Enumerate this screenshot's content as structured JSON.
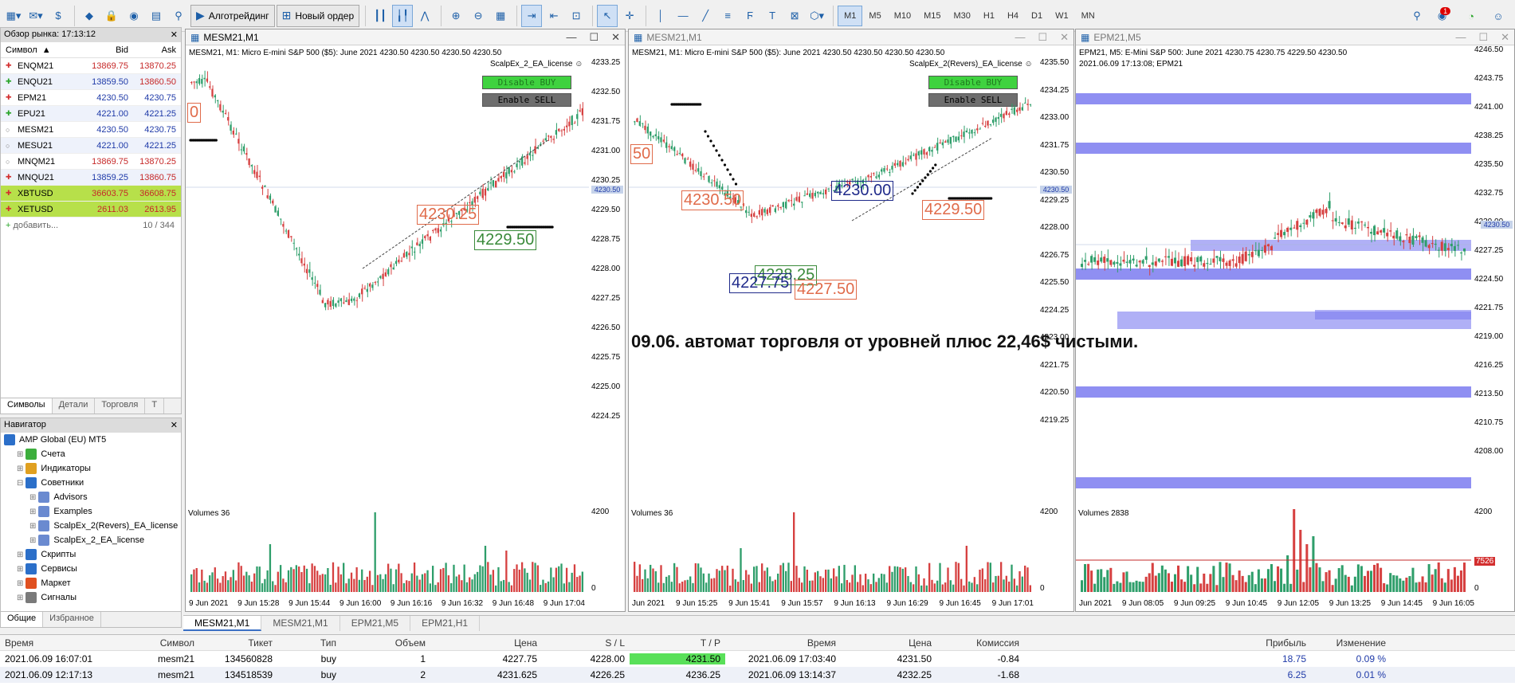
{
  "toolbar": {
    "algo_label": "Алготрейдинг",
    "order_label": "Новый ордер",
    "timeframes": [
      "M1",
      "M5",
      "M10",
      "M15",
      "M30",
      "H1",
      "H4",
      "D1",
      "W1",
      "MN"
    ],
    "active_tf": "M1",
    "notif_count": "1"
  },
  "market": {
    "title": "Обзор рынка: 17:13:12",
    "headers": {
      "symbol": "Символ",
      "bid": "Bid",
      "ask": "Ask"
    },
    "rows": [
      {
        "symbol": "ENQM21",
        "bid": "13869.75",
        "ask": "13870.25"
      },
      {
        "symbol": "ENQU21",
        "bid": "13859.50",
        "ask": "13860.50"
      },
      {
        "symbol": "EPM21",
        "bid": "4230.50",
        "ask": "4230.75"
      },
      {
        "symbol": "EPU21",
        "bid": "4221.00",
        "ask": "4221.25"
      },
      {
        "symbol": "MESM21",
        "bid": "4230.50",
        "ask": "4230.75"
      },
      {
        "symbol": "MESU21",
        "bid": "4221.00",
        "ask": "4221.25"
      },
      {
        "symbol": "MNQM21",
        "bid": "13869.75",
        "ask": "13870.25"
      },
      {
        "symbol": "MNQU21",
        "bid": "13859.25",
        "ask": "13860.75"
      },
      {
        "symbol": "XBTUSD",
        "bid": "36603.75",
        "ask": "36608.75"
      },
      {
        "symbol": "XETUSD",
        "bid": "2611.03",
        "ask": "2613.95"
      }
    ],
    "add_label": "добавить...",
    "count": "10 / 344",
    "tabs": [
      "Символы",
      "Детали",
      "Торговля",
      "Т"
    ]
  },
  "navigator": {
    "title": "Навигатор",
    "items": [
      {
        "label": "AMP Global (EU) MT5",
        "indent": 0
      },
      {
        "label": "Счета",
        "indent": 1
      },
      {
        "label": "Индикаторы",
        "indent": 1
      },
      {
        "label": "Советники",
        "indent": 1
      },
      {
        "label": "Advisors",
        "indent": 2
      },
      {
        "label": "Examples",
        "indent": 2
      },
      {
        "label": "ScalpEx_2(Revers)_EA_license",
        "indent": 2
      },
      {
        "label": "ScalpEx_2_EA_license",
        "indent": 2
      },
      {
        "label": "Скрипты",
        "indent": 1
      },
      {
        "label": "Сервисы",
        "indent": 1
      },
      {
        "label": "Маркет",
        "indent": 1
      },
      {
        "label": "Сигналы",
        "indent": 1
      }
    ],
    "tabs": [
      "Общие",
      "Избранное"
    ]
  },
  "charts": [
    {
      "title": "MESM21,M1",
      "info": "MESM21, M1:  Micro E-mini S&P 500 ($5): June 2021  4230.50 4230.50 4230.50 4230.50",
      "ea": "ScalpEx_2_EA_license",
      "btn1": "Disable BUY",
      "btn2": "Enable SELL",
      "prices": [
        "4233.25",
        "4232.50",
        "4231.75",
        "4231.00",
        "4230.25",
        "4229.50",
        "4228.75",
        "4228.00",
        "4227.25",
        "4226.50",
        "4225.75",
        "4225.00",
        "4224.25"
      ],
      "current": "4230.50",
      "vol": "Volumes 36",
      "vmax": "4200",
      "vmin": "0",
      "times": [
        "9 Jun 2021",
        "9 Jun 15:28",
        "9 Jun 15:44",
        "9 Jun 16:00",
        "9 Jun 16:16",
        "9 Jun 16:32",
        "9 Jun 16:48",
        "9 Jun 17:04"
      ],
      "labels": [
        "4230.25",
        "4229.50",
        "0"
      ]
    },
    {
      "title": "MESM21,M1",
      "info": "MESM21, M1:  Micro E-mini S&P 500 ($5): June 2021  4230.50 4230.50 4230.50 4230.50",
      "ea": "ScalpEx_2(Revers)_EA_license",
      "btn1": "Disable BUY",
      "btn2": "Enable SELL",
      "prices": [
        "4235.50",
        "4234.25",
        "4233.00",
        "4231.75",
        "4230.50",
        "4229.25",
        "4228.00",
        "4226.75",
        "4225.50",
        "4224.25",
        "4223.00",
        "4221.75",
        "4220.50",
        "4219.25"
      ],
      "current": "4230.50",
      "vol": "Volumes 36",
      "vmax": "4200",
      "vmin": "0",
      "times": [
        "Jun 2021",
        "9 Jun 15:25",
        "9 Jun 15:41",
        "9 Jun 15:57",
        "9 Jun 16:13",
        "9 Jun 16:29",
        "9 Jun 16:45",
        "9 Jun 17:01"
      ],
      "labels": [
        "4230.50",
        "4230.00",
        "4228.25",
        "4227.75",
        "4227.50",
        "4229.50",
        "50"
      ]
    },
    {
      "title": "EPM21,M5",
      "info": "EPM21, M5:  E-Mini S&P 500: June 2021  4230.75 4230.75 4229.50 4230.50",
      "info2": "2021.06.09 17:13:08; EPM21",
      "prices": [
        "4246.50",
        "4243.75",
        "4241.00",
        "4238.25",
        "4235.50",
        "4232.75",
        "4230.00",
        "4227.25",
        "4224.50",
        "4221.75",
        "4219.00",
        "4216.25",
        "4213.50",
        "4210.75",
        "4208.00"
      ],
      "current": "4230.50",
      "vol": "Volumes 2838",
      "vmax": "4200",
      "vmin": "0",
      "vlevel": "7526",
      "times": [
        "Jun 2021",
        "9 Jun 08:05",
        "9 Jun 09:25",
        "9 Jun 10:45",
        "9 Jun 12:05",
        "9 Jun 13:25",
        "9 Jun 14:45",
        "9 Jun 16:05"
      ]
    }
  ],
  "overlay_text": "09.06. автомат торговля от уровней плюс 22,46$ чистыми.",
  "chart_tabs": [
    "MESM21,M1",
    "MESM21,M1",
    "EPM21,M5",
    "EPM21,H1"
  ],
  "trades": {
    "headers": [
      "Время",
      "Символ",
      "Тикет",
      "Тип",
      "Объем",
      "Цена",
      "S / L",
      "T / P",
      "Время",
      "Цена",
      "Комиссия",
      "Прибыль",
      "Изменение"
    ],
    "rows": [
      [
        "2021.06.09 16:07:01",
        "mesm21",
        "134560828",
        "buy",
        "1",
        "4227.75",
        "4228.00",
        "4231.50",
        "2021.06.09 17:03:40",
        "4231.50",
        "-0.84",
        "18.75",
        "0.09 %"
      ],
      [
        "2021.06.09 12:17:13",
        "mesm21",
        "134518539",
        "buy",
        "2",
        "4231.625",
        "4226.25",
        "4236.25",
        "2021.06.09 13:14:37",
        "4232.25",
        "-1.68",
        "6.25",
        "0.01 %"
      ]
    ]
  },
  "colors": {
    "bull": "#2e9e6a",
    "bear": "#d64040",
    "band": "#7b7bf0"
  }
}
